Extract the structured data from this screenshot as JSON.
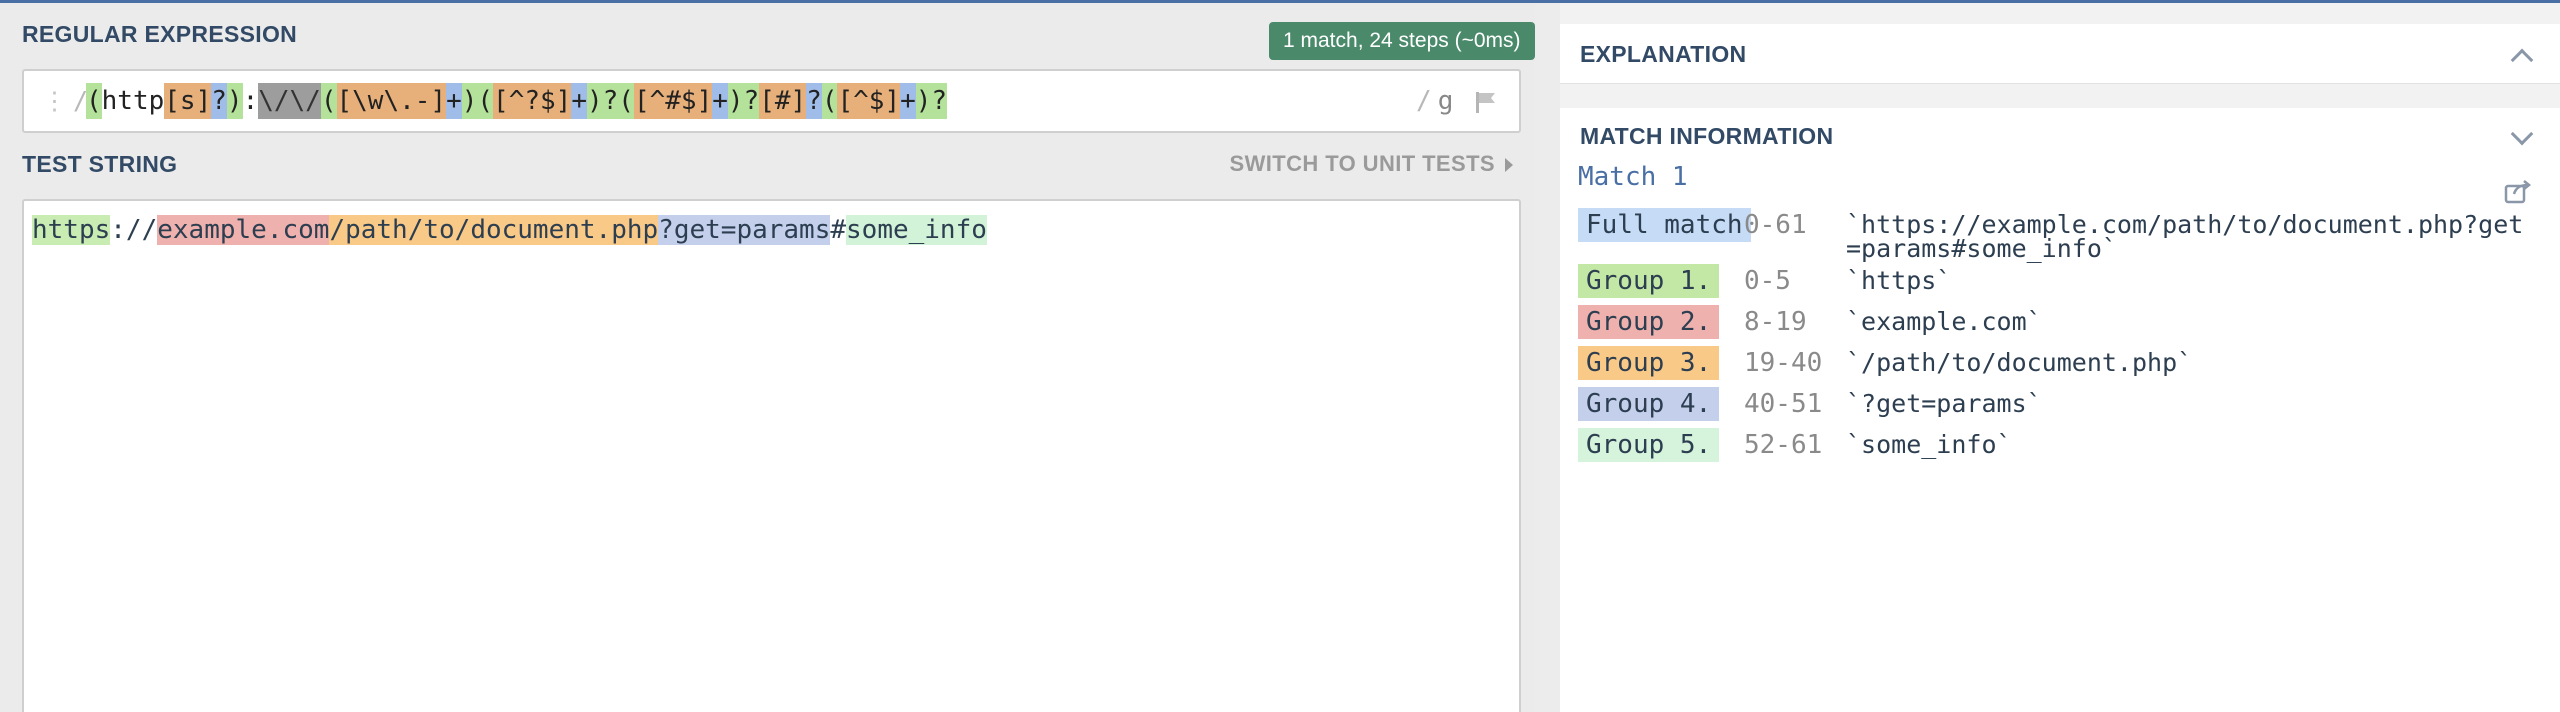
{
  "regex_section": {
    "title": "REGULAR EXPRESSION",
    "badge": "1 match, 24 steps (~0ms)",
    "prefix": "/",
    "flags": "g",
    "suffix_slash": "/",
    "tokens": [
      {
        "text": "(",
        "cls": "g-green"
      },
      {
        "text": "http",
        "cls": ""
      },
      {
        "text": "[s]",
        "cls": "g-orange"
      },
      {
        "text": "?",
        "cls": "g-blue"
      },
      {
        "text": ")",
        "cls": "g-green"
      },
      {
        "text": ":",
        "cls": ""
      },
      {
        "text": "\\/\\/",
        "cls": "g-grey"
      },
      {
        "text": "(",
        "cls": "g-green"
      },
      {
        "text": "[\\w\\.-]",
        "cls": "g-orange"
      },
      {
        "text": "+",
        "cls": "g-blue"
      },
      {
        "text": ")(",
        "cls": "g-green"
      },
      {
        "text": "[^?$]",
        "cls": "g-orange"
      },
      {
        "text": "+",
        "cls": "g-blue"
      },
      {
        "text": ")?(",
        "cls": "g-green"
      },
      {
        "text": "[^#$]",
        "cls": "g-orange"
      },
      {
        "text": "+",
        "cls": "g-blue"
      },
      {
        "text": ")?",
        "cls": "g-green"
      },
      {
        "text": "[#]",
        "cls": "g-orange"
      },
      {
        "text": "?",
        "cls": "g-blue"
      },
      {
        "text": "(",
        "cls": "g-green"
      },
      {
        "text": "[^$]",
        "cls": "g-orange"
      },
      {
        "text": "+",
        "cls": "g-blue"
      },
      {
        "text": ")?",
        "cls": "g-green"
      }
    ]
  },
  "test_section": {
    "title": "TEST STRING",
    "switch_label": "SWITCH TO UNIT TESTS",
    "segments": [
      {
        "text": "https",
        "cls": "m-green"
      },
      {
        "text": "://",
        "cls": ""
      },
      {
        "text": "example.com",
        "cls": "m-pink"
      },
      {
        "text": "/path/to/document.php",
        "cls": "m-orange"
      },
      {
        "text": "?get=params",
        "cls": "m-blue"
      },
      {
        "text": "#",
        "cls": ""
      },
      {
        "text": "some_info",
        "cls": "m-mint"
      }
    ]
  },
  "explanation": {
    "title": "EXPLANATION"
  },
  "match_info": {
    "title": "MATCH INFORMATION",
    "match_label": "Match 1",
    "rows": [
      {
        "label": "Full match",
        "range": "0-61",
        "value": "`https://example.com/path/to/document.php?get=params#some_info`",
        "cls": "lbl-full",
        "tall": true
      },
      {
        "label": "Group 1.",
        "range": "0-5",
        "value": "`https`",
        "cls": "lbl-g1",
        "tall": false
      },
      {
        "label": "Group 2.",
        "range": "8-19",
        "value": "`example.com`",
        "cls": "lbl-g2",
        "tall": false
      },
      {
        "label": "Group 3.",
        "range": "19-40",
        "value": "`/path/to/document.php`",
        "cls": "lbl-g3",
        "tall": false
      },
      {
        "label": "Group 4.",
        "range": "40-51",
        "value": "`?get=params`",
        "cls": "lbl-g4",
        "tall": false
      },
      {
        "label": "Group 5.",
        "range": "52-61",
        "value": "`some_info`",
        "cls": "lbl-g5",
        "tall": false
      }
    ]
  },
  "icons": {
    "flag": "flag-icon",
    "share": "share-icon",
    "collapse": "chevron-up-icon",
    "expand": "chevron-down-icon",
    "grip": "grip-icon"
  }
}
